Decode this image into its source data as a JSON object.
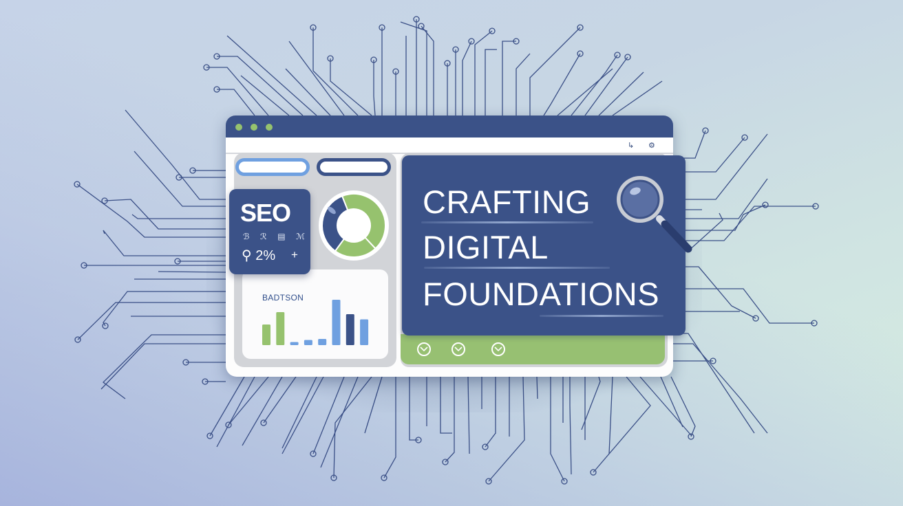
{
  "window": {
    "traffic_lights": [
      "green-dot",
      "green-dot",
      "green-dot"
    ],
    "toolbar_icons": [
      {
        "name": "share-icon",
        "glyph": "↳"
      },
      {
        "name": "settings-icon",
        "glyph": "⚙"
      }
    ]
  },
  "left_panel": {
    "pills": [
      {
        "name": "search-pill-light",
        "value": ""
      },
      {
        "name": "search-pill-dark",
        "value": ""
      }
    ],
    "seo_card": {
      "title": "SEO",
      "icons": [
        "ℬ",
        "ℛ",
        "▤",
        "ℳ"
      ],
      "stat_icon": "⚲",
      "stat": "2%",
      "plus": "+"
    },
    "donut": {
      "segments": [
        {
          "label": "green-large",
          "value": 44,
          "color": "#96c26e"
        },
        {
          "label": "green-small",
          "value": 22,
          "color": "#96c26e"
        },
        {
          "label": "blue",
          "value": 34,
          "color": "#3b5288"
        }
      ]
    },
    "bar_chart": {
      "title": "BADTSON",
      "values": [
        20,
        32,
        3,
        5,
        6,
        44,
        30,
        25
      ],
      "colors": [
        "#96c26e",
        "#96c26e",
        "#6fa0e0",
        "#6fa0e0",
        "#6fa0e0",
        "#6fa0e0",
        "#3b5288",
        "#6fa0e0"
      ]
    }
  },
  "hero": {
    "line1": "CRAFTING",
    "line2": "DIGITAL",
    "line3": "FOUNDATIONS"
  },
  "footer": {
    "buttons": [
      "chevron-down",
      "chevron-down",
      "chevron-down"
    ]
  },
  "colors": {
    "brand_blue": "#3b5288",
    "accent_green": "#96c26e",
    "light_blue": "#6fa0e0",
    "panel_gray": "#d2d4d8"
  }
}
